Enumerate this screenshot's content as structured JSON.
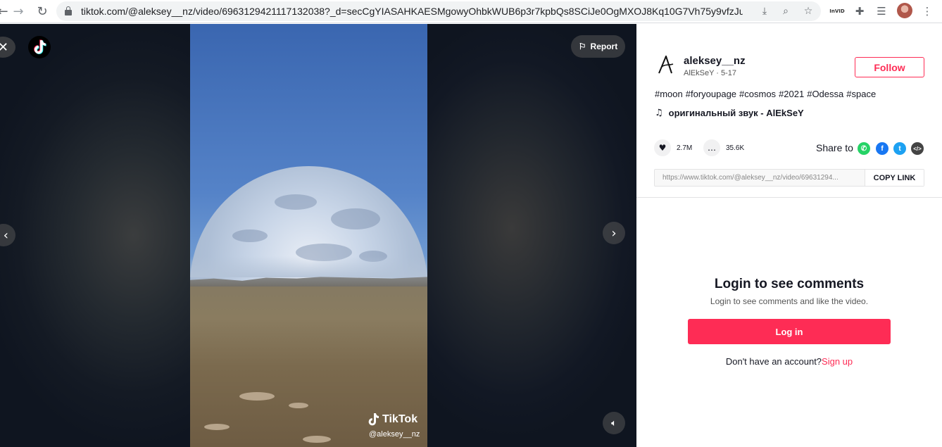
{
  "browser": {
    "url": "tiktok.com/@aleksey__nz/video/6963129421117132038?_d=secCgYIASAHKAESMgowyOhbkWUB6p3r7kpbQs8SCiJe0OgMXOJ8Kq10G7Vh75y9vfzJurSLj...",
    "invid_label": "InVID"
  },
  "video": {
    "report_label": "Report",
    "watermark_brand": "TikTok",
    "watermark_handle": "@aleksey__nz"
  },
  "author": {
    "username": "aleksey__nz",
    "nickname": "AlEkSeY",
    "date": "5-17",
    "follow_label": "Follow"
  },
  "description": {
    "tags": [
      "#moon",
      "#foryoupage",
      "#cosmos",
      "#2021",
      "#Odessa",
      "#space"
    ],
    "music": "оригинальный звук - AlEkSeY"
  },
  "stats": {
    "likes": "2.7M",
    "comments": "35.6K",
    "share_label": "Share to"
  },
  "share_link": {
    "url": "https://www.tiktok.com/@aleksey__nz/video/69631294...",
    "copy_label": "COPY LINK"
  },
  "comments_gate": {
    "title": "Login to see comments",
    "subtitle": "Login to see comments and like the video.",
    "login_label": "Log in",
    "no_account": "Don't have an account?",
    "signup_label": "Sign up"
  }
}
